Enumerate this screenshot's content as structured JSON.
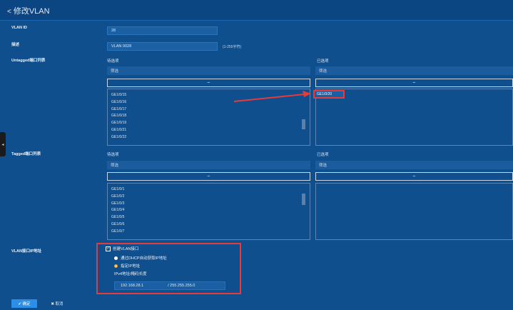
{
  "header": {
    "back_label": "修改VLAN"
  },
  "form": {
    "vlan_id_label": "VLAN ID",
    "vlan_id_value": "28",
    "desc_label": "描述",
    "desc_value": "VLAN 0028",
    "desc_hint": "(1-255字符)",
    "untagged_label": "Untagged端口列表",
    "tagged_label": "Tagged端口列表",
    "vlan_if_label": "VLAN接口IP地址"
  },
  "untagged": {
    "available_title": "待选项",
    "selected_title": "已选项",
    "filter_placeholder": "筛选",
    "move_label": "⇔",
    "available_items": [
      "GE1/0/15",
      "GE1/0/16",
      "GE1/0/17",
      "GE1/0/18",
      "GE1/0/19",
      "GE1/0/21",
      "GE1/0/22"
    ],
    "selected_items": [
      "GE1/0/20"
    ]
  },
  "tagged": {
    "available_title": "待选项",
    "selected_title": "已选项",
    "filter_placeholder": "筛选",
    "move_label": "⇔",
    "available_items": [
      "GE1/0/1",
      "GE1/0/2",
      "GE1/0/3",
      "GE1/0/4",
      "GE1/0/5",
      "GE1/0/6",
      "GE1/0/7"
    ]
  },
  "vlan_if": {
    "create_label": "创建VLAN接口",
    "dhcp_label": "通过DHCP自动获取IP地址",
    "manual_label": "指定IP地址",
    "ip_mask_label": "IPv4地址/掩码长度",
    "ip_value": "192.168.28.1",
    "mask_value": "/ 255.255.255.0"
  },
  "actions": {
    "ok_label": "✔ 确定",
    "cancel_label": "✖ 取消"
  },
  "colors": {
    "background": "#0f4f8e",
    "highlight": "#e53b3b",
    "primary_button": "#2d8ee8"
  }
}
